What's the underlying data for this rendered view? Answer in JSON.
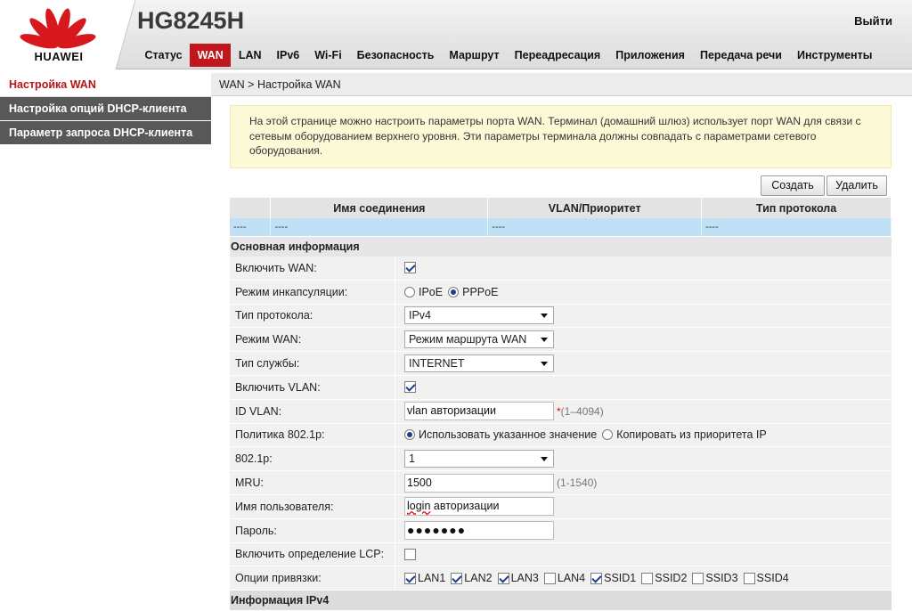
{
  "header": {
    "brand": "HUAWEI",
    "model": "HG8245H",
    "logout": "Выйти",
    "brand_color": "#c0161c"
  },
  "nav": {
    "tabs": [
      "Статус",
      "WAN",
      "LAN",
      "IPv6",
      "Wi-Fi",
      "Безопасность",
      "Маршрут",
      "Переадресация",
      "Приложения",
      "Передача речи",
      "Инструменты"
    ],
    "active": "WAN"
  },
  "sidebar": {
    "items": [
      "Настройка WAN",
      "Настройка опций DHCP-клиента",
      "Параметр запроса DHCP-клиента"
    ]
  },
  "breadcrumb": "WAN > Настройка WAN",
  "info": "На этой странице можно настроить параметры порта WAN. Терминал (домашний шлюз) использует порт WAN для связи с сетевым оборудованием верхнего уровня. Эти параметры терминала должны совпадать с параметрами сетевого оборудования.",
  "buttons": {
    "create": "Создать",
    "delete": "Удалить"
  },
  "table": {
    "headers": [
      "",
      "Имя соединения",
      "VLAN/Приоритет",
      "Тип протокола"
    ],
    "row": [
      "----",
      "----",
      "----",
      "----"
    ]
  },
  "sections": {
    "basic": "Основная информация",
    "ipv4": "Информация IPv4"
  },
  "form": {
    "enable_wan": {
      "label": "Включить WAN:"
    },
    "encap": {
      "label": "Режим инкапсуляции:",
      "opt1": "IPoE",
      "opt2": "PPPoE",
      "selected": "PPPoE"
    },
    "protocol": {
      "label": "Тип протокола:",
      "value": "IPv4"
    },
    "wan_mode": {
      "label": "Режим WAN:",
      "value": "Режим маршрута WAN"
    },
    "service": {
      "label": "Тип службы:",
      "value": "INTERNET"
    },
    "enable_vlan": {
      "label": "Включить VLAN:"
    },
    "vlan_id": {
      "label": "ID VLAN:",
      "value": "vlan авторизации",
      "hint_req": "*",
      "hint": "(1–4094)"
    },
    "policy": {
      "label": "Политика 802.1p:",
      "opt1": "Использовать указанное значение",
      "opt2": "Копировать из приоритета IP"
    },
    "p8021": {
      "label": "802.1p:",
      "value": "1"
    },
    "mru": {
      "label": "MRU:",
      "value": "1500",
      "hint": "(1-1540)"
    },
    "username": {
      "label": "Имя пользователя:",
      "value_word1": "login",
      "value_word2": " авторизации"
    },
    "password": {
      "label": "Пароль:",
      "value": "●●●●●●●"
    },
    "lcp": {
      "label": "Включить определение LCP:"
    },
    "binding": {
      "label": "Опции привязки:",
      "options": [
        "LAN1",
        "LAN2",
        "LAN3",
        "LAN4",
        "SSID1",
        "SSID2",
        "SSID3",
        "SSID4"
      ]
    }
  }
}
